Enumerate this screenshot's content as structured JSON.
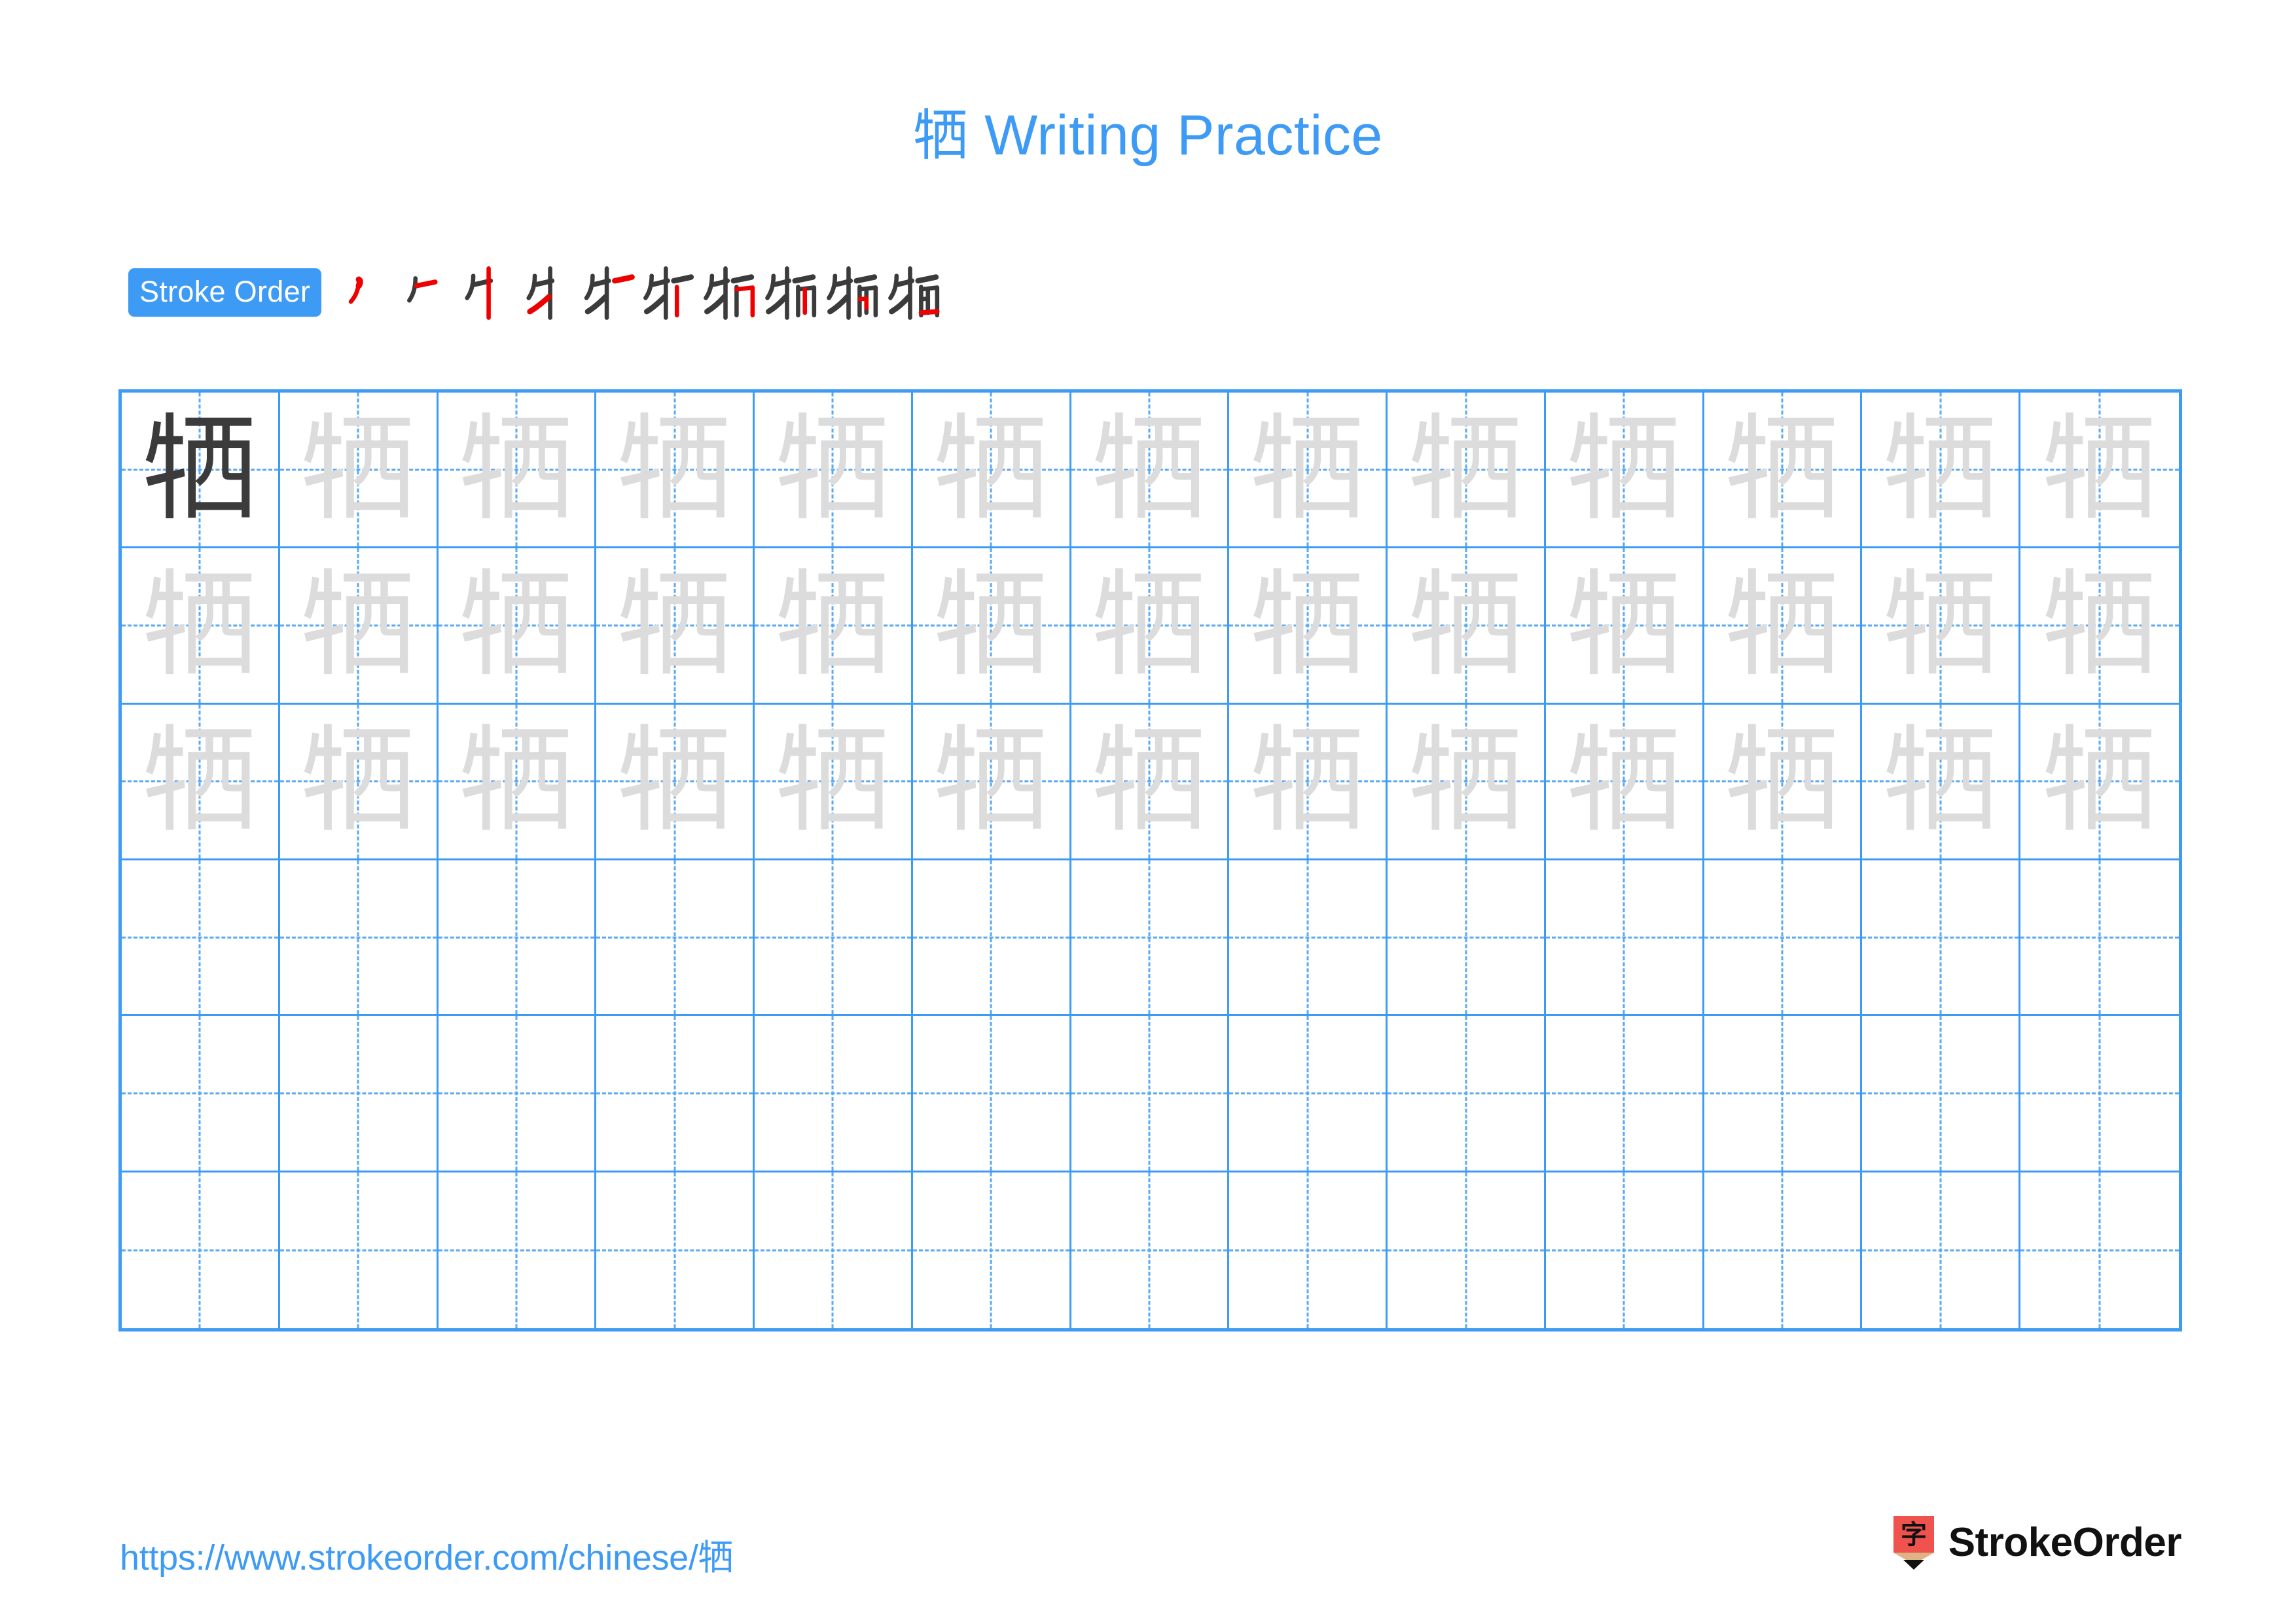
{
  "page": {
    "character": "牺",
    "title": "牺 Writing Practice",
    "title_suffix": " Writing Practice",
    "background_color": "#ffffff",
    "accent_color": "#3d9bf5",
    "model_ink_color": "#3b3b3b",
    "trace_ink_color": "#dcdcdc",
    "new_stroke_color": "#ee0000"
  },
  "stroke_order": {
    "badge_label": "Stroke Order",
    "badge_background": "#3d9bf5",
    "badge_text_color": "#ffffff",
    "total_strokes": 10,
    "steps": [
      {
        "index": 1,
        "cumulative_strokes": 1,
        "new_stroke": "丿 (pie)"
      },
      {
        "index": 2,
        "cumulative_strokes": 2,
        "new_stroke": "一 (heng short)"
      },
      {
        "index": 3,
        "cumulative_strokes": 3,
        "new_stroke": "丨 (shu)"
      },
      {
        "index": 4,
        "cumulative_strokes": 4,
        "new_stroke": "丿 (pie)"
      },
      {
        "index": 5,
        "cumulative_strokes": 5,
        "new_stroke": "一 (heng)"
      },
      {
        "index": 6,
        "cumulative_strokes": 6,
        "new_stroke": "丨 (shu)"
      },
      {
        "index": 7,
        "cumulative_strokes": 7,
        "new_stroke": "𠃌 (heng zhe)"
      },
      {
        "index": 8,
        "cumulative_strokes": 8,
        "new_stroke": "丨 (shu)"
      },
      {
        "index": 9,
        "cumulative_strokes": 9,
        "new_stroke": "𠃍 (zhe)"
      },
      {
        "index": 10,
        "cumulative_strokes": 10,
        "new_stroke": "一 (heng bottom)"
      }
    ]
  },
  "practice_grid": {
    "columns": 13,
    "rows": 6,
    "border_color": "#3d9bf5",
    "guide_line_color": "#5aa9f2",
    "cell_contents": [
      [
        "model",
        "trace",
        "trace",
        "trace",
        "trace",
        "trace",
        "trace",
        "trace",
        "trace",
        "trace",
        "trace",
        "trace",
        "trace"
      ],
      [
        "trace",
        "trace",
        "trace",
        "trace",
        "trace",
        "trace",
        "trace",
        "trace",
        "trace",
        "trace",
        "trace",
        "trace",
        "trace"
      ],
      [
        "trace",
        "trace",
        "trace",
        "trace",
        "trace",
        "trace",
        "trace",
        "trace",
        "trace",
        "trace",
        "trace",
        "trace",
        "trace"
      ],
      [
        "blank",
        "blank",
        "blank",
        "blank",
        "blank",
        "blank",
        "blank",
        "blank",
        "blank",
        "blank",
        "blank",
        "blank",
        "blank"
      ],
      [
        "blank",
        "blank",
        "blank",
        "blank",
        "blank",
        "blank",
        "blank",
        "blank",
        "blank",
        "blank",
        "blank",
        "blank",
        "blank"
      ],
      [
        "blank",
        "blank",
        "blank",
        "blank",
        "blank",
        "blank",
        "blank",
        "blank",
        "blank",
        "blank",
        "blank",
        "blank",
        "blank"
      ]
    ]
  },
  "footer": {
    "url": "https://www.strokeorder.com/chinese/牺",
    "url_prefix": "https://www.strokeorder.com/chinese/",
    "brand_name": "StrokeOrder",
    "brand_mark_character": "字",
    "brand_mark_color": "#f0524d",
    "brand_mark_tip_color": "#e0b387"
  }
}
